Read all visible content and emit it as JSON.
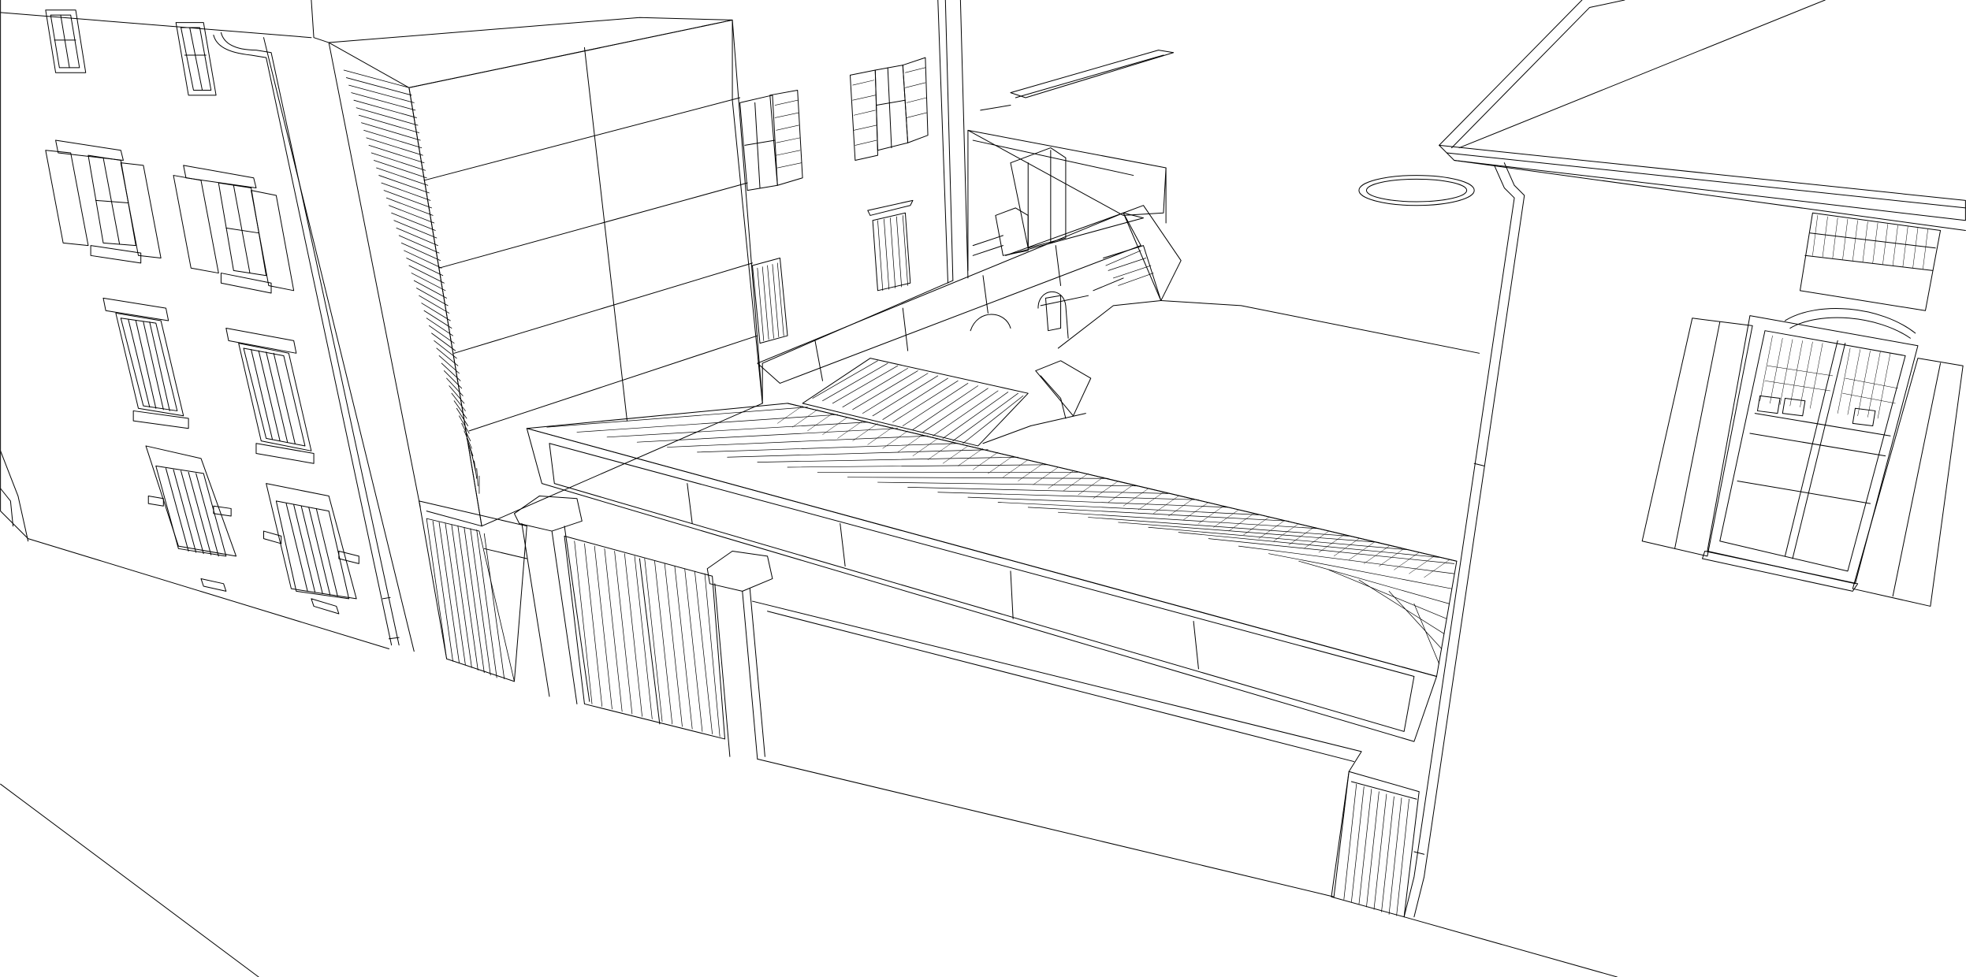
{
  "drawing": {
    "style": "black line sketch on white",
    "stroke_color": "#000000",
    "background_color": "#ffffff",
    "components": [
      "left-building",
      "center-building",
      "covered-walkway",
      "right-building",
      "street-and-wall"
    ]
  }
}
